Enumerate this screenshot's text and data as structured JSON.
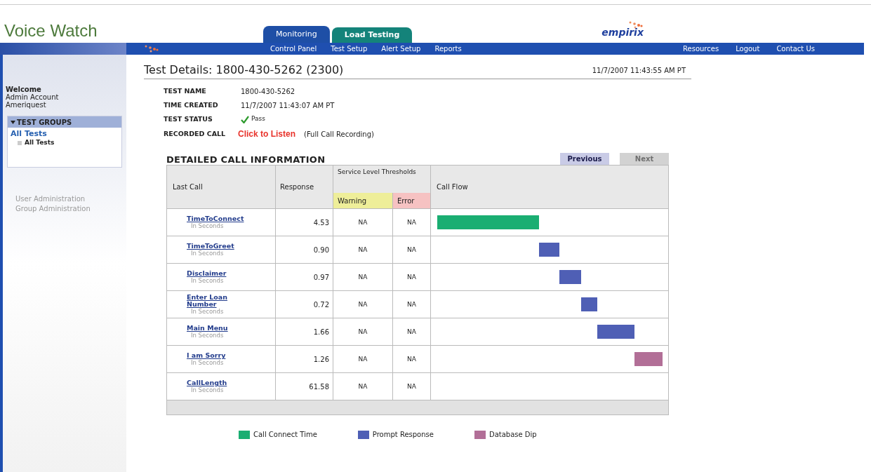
{
  "header": {
    "title": "Voice Watch",
    "vendor_logo": "empirix"
  },
  "tabs": [
    {
      "label": "Monitoring",
      "selected": true
    },
    {
      "label": "Load Testing",
      "selected": false
    }
  ],
  "nav": {
    "left": [
      "Control Panel",
      "Test Setup",
      "Alert Setup",
      "Reports"
    ],
    "right": [
      "Resources",
      "Logout",
      "Contact Us"
    ]
  },
  "sidebar": {
    "welcome": {
      "title": "Welcome",
      "lines": [
        "Admin Account",
        "Ameriquest"
      ]
    },
    "group_panel": {
      "title": "TEST GROUPS",
      "expanded": true,
      "items": [
        {
          "label": "All Tests",
          "children": [
            {
              "label": "All Tests"
            }
          ]
        }
      ]
    },
    "links": [
      "User Administration",
      "Group Administration"
    ]
  },
  "main": {
    "title": "Test Details: 1800-430-5262 (2300)",
    "timestamp": "11/7/2007 11:43:55 AM PT",
    "details": [
      {
        "kind": "text",
        "label": "TEST NAME",
        "value": "1800-430-5262"
      },
      {
        "kind": "text",
        "label": "TIME CREATED",
        "value": "11/7/2007 11:43:07 AM PT"
      },
      {
        "kind": "status",
        "label": "TEST STATUS",
        "value": "Pass"
      },
      {
        "kind": "recording",
        "label": "RECORDED CALL",
        "link": "Click to Listen",
        "note": "(Full Call Recording)"
      }
    ],
    "section_title": "DETAILED CALL INFORMATION",
    "pager": [
      {
        "label": "Previous",
        "disabled": false
      },
      {
        "label": "Next",
        "disabled": true
      }
    ],
    "table": {
      "columns": {
        "last_call": "Last Call",
        "response": "Response",
        "thresholds": "Service Level Thresholds",
        "warning": "Warning",
        "error": "Error",
        "call_flow": "Call Flow"
      },
      "rows": [
        {
          "kind": "connect",
          "name": "TimeToConnect",
          "unit": "In Seconds",
          "response": "4.53",
          "warning": "NA",
          "error": "NA"
        },
        {
          "kind": "prompt",
          "name": "TimeToGreet",
          "unit": "In Seconds",
          "response": "0.90",
          "warning": "NA",
          "error": "NA"
        },
        {
          "kind": "prompt",
          "name": "Disclaimer",
          "unit": "In Seconds",
          "response": "0.97",
          "warning": "NA",
          "error": "NA"
        },
        {
          "kind": "prompt",
          "name": "Enter Loan Number",
          "unit": "In Seconds",
          "response": "0.72",
          "warning": "NA",
          "error": "NA"
        },
        {
          "kind": "prompt",
          "name": "Main Menu",
          "unit": "In Seconds",
          "response": "1.66",
          "warning": "NA",
          "error": "NA"
        },
        {
          "kind": "database",
          "name": "I am Sorry",
          "unit": "In Seconds",
          "response": "1.26",
          "warning": "NA",
          "error": "NA"
        },
        {
          "kind": "total",
          "name": "CallLength",
          "unit": "In Seconds",
          "response": "61.58",
          "warning": "NA",
          "error": "NA"
        }
      ]
    },
    "legend": [
      {
        "kind": "connect",
        "label": "Call Connect Time",
        "color": "#1aae72"
      },
      {
        "kind": "prompt",
        "label": "Prompt Response",
        "color": "#4f5fb5"
      },
      {
        "kind": "database",
        "label": "Database Dip",
        "color": "#b26f97"
      }
    ]
  }
}
